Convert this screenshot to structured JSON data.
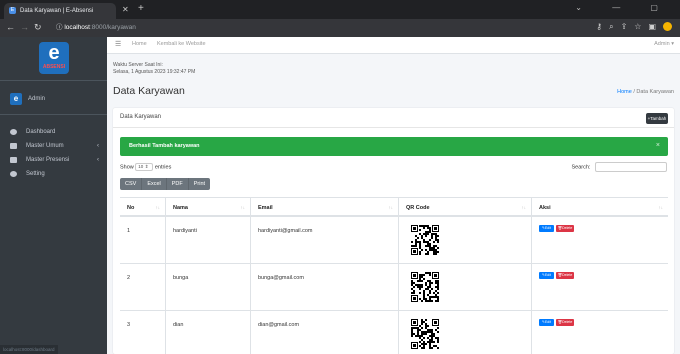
{
  "browser": {
    "tab_title": "Data Karyawan | E-Absensi",
    "tab_favicon": "E",
    "url_host": "localhost",
    "url_path": ":8000/karyawan"
  },
  "sidebar": {
    "logo_letter": "e",
    "logo_text": "ABSENSI",
    "user_icon_letter": "e",
    "user_name": "Admin",
    "items": [
      {
        "label": "Dashboard",
        "icon": "dashboard-icon"
      },
      {
        "label": "Master Umum",
        "icon": "folder-icon",
        "arrow": "‹"
      },
      {
        "label": "Master Presensi",
        "icon": "folder-icon",
        "arrow": "‹"
      },
      {
        "label": "Setting",
        "icon": "gear-icon"
      }
    ],
    "status_url": "localhost:8000/dashboard"
  },
  "navbar": {
    "home_label": "Home",
    "website_label": "Kembali ke Website",
    "user_label": "Admin"
  },
  "content": {
    "waktu_label": "Waktu Server Saat Ini:",
    "waktu_value": "Selasa, 1 Agustus 2023 19:32:47 PM",
    "title": "Data Karyawan",
    "breadcrumb_home": "Home",
    "breadcrumb_sep": "/",
    "breadcrumb_current": "Data Karyawan"
  },
  "card": {
    "title": "Data Karyawan",
    "add_button": "+Tambah"
  },
  "alert": {
    "text": "Berhasil Tambah karyawan",
    "close": "×"
  },
  "datatable": {
    "show_label": "Show",
    "entries_value": "10",
    "entries_label": "entries",
    "search_label": "Search:",
    "buttons": [
      "CSV",
      "Excel",
      "PDF",
      "Print"
    ],
    "columns": [
      "No",
      "Nama",
      "Email",
      "QR Code",
      "Aksi"
    ],
    "rows": [
      {
        "no": "1",
        "nama": "hardiyanti",
        "email": "hardiyanti@gmail.com"
      },
      {
        "no": "2",
        "nama": "bunga",
        "email": "bunga@gmail.com"
      },
      {
        "no": "3",
        "nama": "dian",
        "email": "dian@gmail.com"
      }
    ],
    "edit_label": "Edit",
    "delete_label": "Delete"
  },
  "colors": {
    "sidebar_bg": "#343a40",
    "alert_success": "#28a745",
    "edit_btn": "#007bff",
    "delete_btn": "#dc3545",
    "dt_btn": "#6c757d"
  }
}
